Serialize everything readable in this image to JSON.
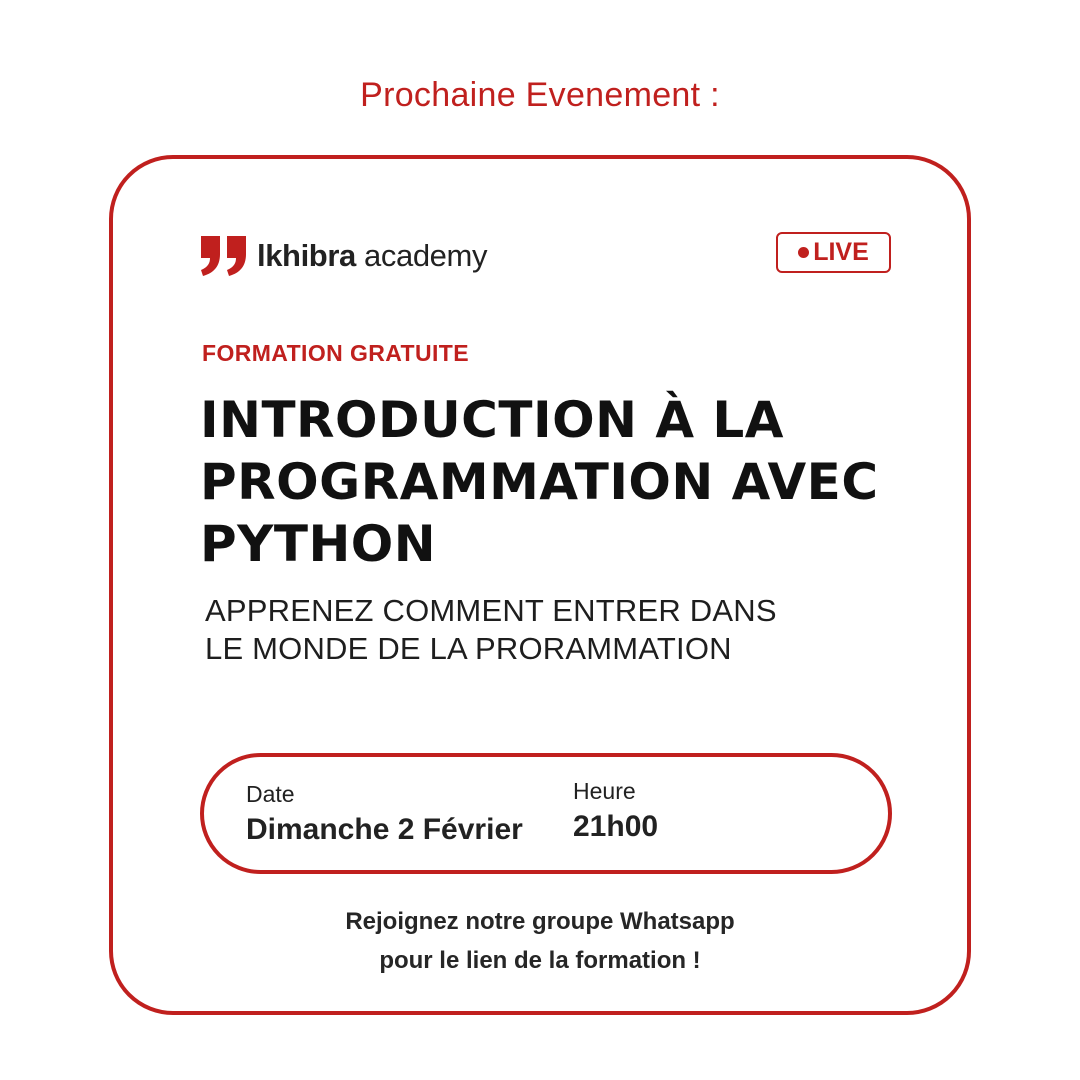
{
  "header": {
    "label": "Prochaine Evenement :"
  },
  "logo": {
    "icon": "quote-mark-logo-icon",
    "brand_bold": "lkhibra",
    "brand_regular": " academy"
  },
  "badge": {
    "icon": "live-dot-icon",
    "label": "LIVE"
  },
  "event": {
    "kicker": "FORMATION GRATUITE",
    "title_lines": [
      "INTRODUCTION À LA",
      "PROGRAMMATION AVEC",
      "PYTHON"
    ],
    "subtitle_lines": [
      "APPRENEZ COMMENT ENTRER DANS",
      "LE MONDE DE LA PRORAMMATION"
    ]
  },
  "details": {
    "date_label": "Date",
    "date_value": "Dimanche 2 Février",
    "time_label": "Heure",
    "time_value": "21h00"
  },
  "footer": {
    "lines": [
      "Rejoignez notre groupe Whatsapp",
      "pour le lien de la formation !"
    ]
  },
  "colors": {
    "accent": "#c0201e",
    "text": "#111111",
    "background": "#ffffff"
  }
}
